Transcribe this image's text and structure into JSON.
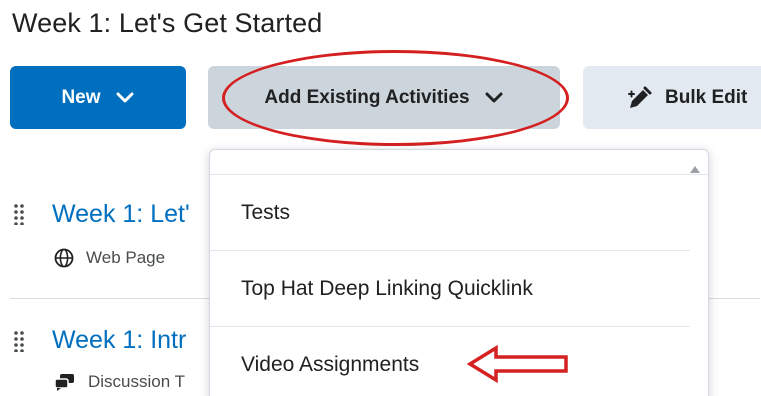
{
  "page": {
    "title": "Week 1: Let's Get Started"
  },
  "toolbar": {
    "new_label": "New",
    "add_existing_label": "Add Existing Activities",
    "bulk_edit_label": "Bulk Edit"
  },
  "lessons": [
    {
      "title": "Week 1: Let'",
      "type": "Web Page",
      "icon": "globe-icon"
    },
    {
      "title": "Week 1: Intr",
      "type": "Discussion T",
      "icon": "discussion-icon"
    }
  ],
  "dropdown": {
    "items": [
      {
        "label": "Tests"
      },
      {
        "label": "Top Hat Deep Linking Quicklink"
      },
      {
        "label": "Video Assignments"
      }
    ]
  },
  "annotations": {
    "highlight_color": "#d42020"
  },
  "colors": {
    "primary": "#006fbf",
    "secondary_button": "#cdd5dc",
    "tertiary_button": "#e3e9f1"
  }
}
